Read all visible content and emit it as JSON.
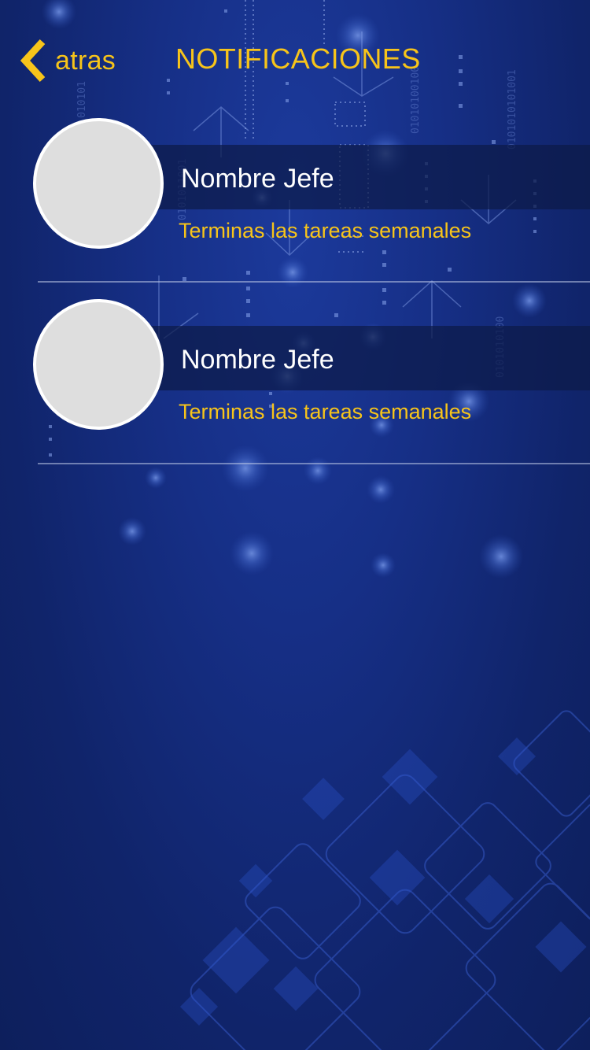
{
  "header": {
    "back_label": "atras",
    "back_icon": "chevron-left-icon",
    "title": "NOTIFICACIONES"
  },
  "notifications": [
    {
      "name": "Nombre Jefe",
      "message": "Terminas las tareas semanales"
    },
    {
      "name": "Nombre Jefe",
      "message": "Terminas las tareas semanales"
    }
  ],
  "colors": {
    "accent": "#f7c41a",
    "background": "#162f86",
    "avatar_placeholder": "#dedede"
  }
}
